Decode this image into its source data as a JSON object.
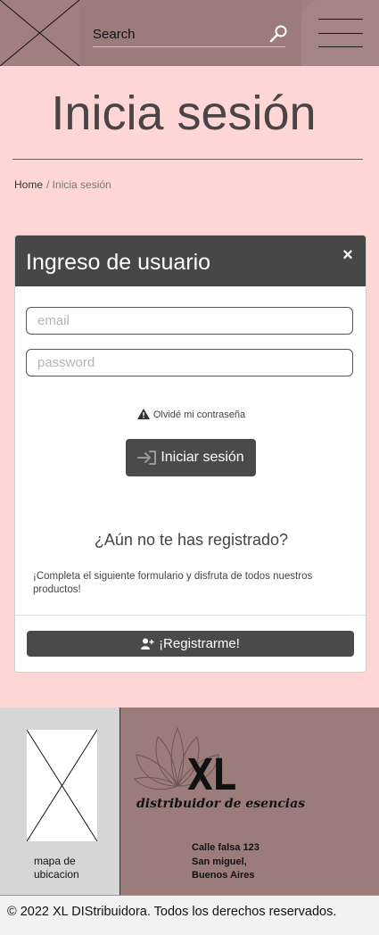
{
  "header": {
    "search_label": "Search",
    "icons": {
      "logo": "logo-placeholder-icon",
      "search": "search-icon",
      "menu": "hamburger-menu-icon"
    }
  },
  "page": {
    "title": "Inicia sesión",
    "breadcrumb": {
      "home": "Home",
      "current": "/ Inicia sesión"
    }
  },
  "login_card": {
    "title": "Ingreso de usuario",
    "close": "×",
    "email_placeholder": "email",
    "password_placeholder": "password",
    "forgot_label": "Olvidé mi contraseña",
    "login_button": "Iniciar sesión",
    "register_heading": "¿Aún no te has registrado?",
    "register_text": "¡Completa el siguiente formulario y disfruta de todos nuestros productos!",
    "register_button": "¡Registrarme!"
  },
  "footer": {
    "map_label": "mapa de ubicacion",
    "brand": "XL",
    "tagline": "distribuidor de esencias",
    "address": [
      "Calle falsa 123",
      "San miguel,",
      "Buenos Aires"
    ],
    "copyright": "© 2022 XL DIStribuidora. Todos los derechos reservados."
  },
  "colors": {
    "background": "#ffd6d6",
    "header": "#a27f7f",
    "card_header": "#474747",
    "button": "#4a4a4a",
    "footer_brand": "#9c7b7b",
    "footer_map": "#d6d6d6"
  }
}
